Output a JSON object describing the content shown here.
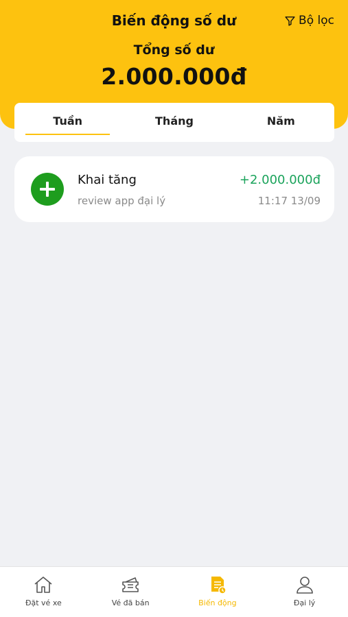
{
  "header": {
    "title": "Biến động số dư",
    "filter_label": "Bộ lọc",
    "filter_icon": "funnel-icon",
    "balance_label": "Tổng số dư",
    "balance_value": "2.000.000đ"
  },
  "tabs": [
    {
      "label": "Tuần",
      "active": true
    },
    {
      "label": "Tháng",
      "active": false
    },
    {
      "label": "Năm",
      "active": false
    }
  ],
  "transactions": [
    {
      "title": "Khai tăng",
      "description": "review app đại lý",
      "amount": "+2.000.000đ",
      "time": "11:17 13/09",
      "icon": "plus-circle-icon"
    }
  ],
  "bottom_nav": [
    {
      "label": "Đặt vé xe",
      "icon": "home-icon",
      "active": false
    },
    {
      "label": "Vé đã bán",
      "icon": "ticket-icon",
      "active": false
    },
    {
      "label": "Biến động",
      "icon": "document-clock-icon",
      "active": true
    },
    {
      "label": "Đại lý",
      "icon": "user-icon",
      "active": false
    }
  ],
  "colors": {
    "brand_yellow": "#fdc20f",
    "positive_green": "#1aa35b",
    "icon_green": "#1e9d1e",
    "background": "#f0f1f4"
  }
}
